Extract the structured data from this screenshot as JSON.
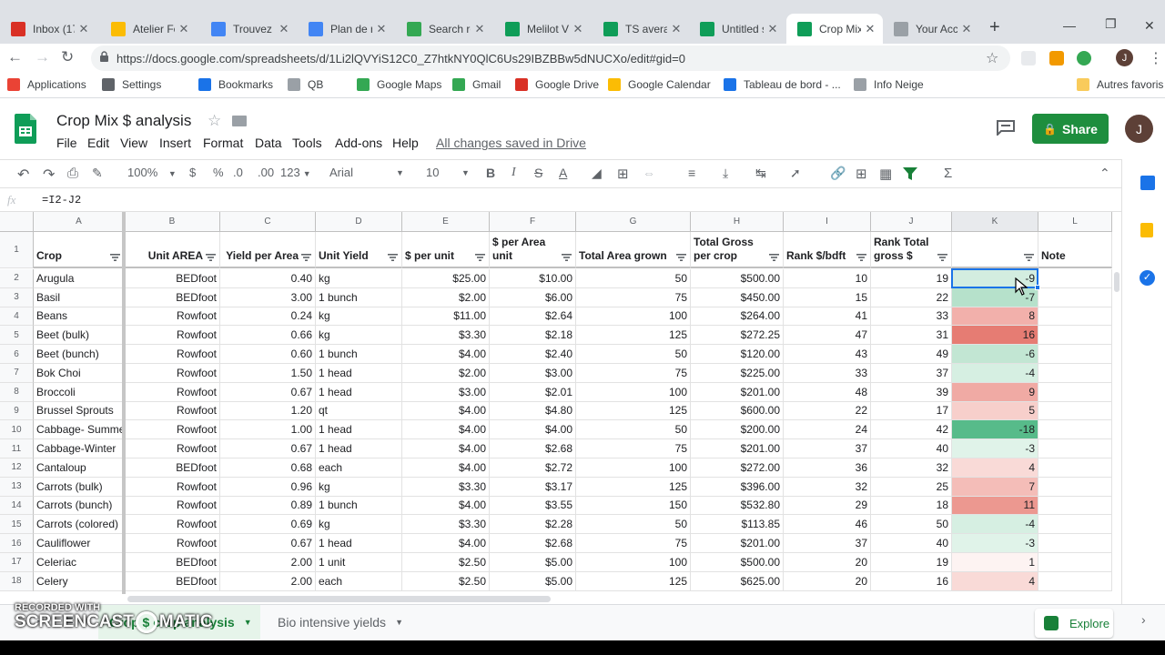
{
  "browser": {
    "tabs": [
      {
        "title": "Inbox (17",
        "color": "#d93025"
      },
      {
        "title": "Atelier Fe",
        "color": "#fbbc04"
      },
      {
        "title": "Trouvez l",
        "color": "#4285f4"
      },
      {
        "title": "Plan de r",
        "color": "#4285f4"
      },
      {
        "title": "Search re",
        "color": "#34a853"
      },
      {
        "title": "Melilot V",
        "color": "#0f9d58"
      },
      {
        "title": "TS averag",
        "color": "#0f9d58"
      },
      {
        "title": "Untitled s",
        "color": "#0f9d58"
      },
      {
        "title": "Crop Mix",
        "color": "#0f9d58"
      },
      {
        "title": "Your Acco",
        "color": "#9aa0a6"
      }
    ],
    "url": "https://docs.google.com/spreadsheets/d/1Li2lQVYiS12C0_Z7htkNY0QlC6Us29IBZBBw5dNUCXo/edit#gid=0",
    "bookmarks": [
      "Applications",
      "Settings",
      "Bookmarks",
      "QB",
      "Google Maps",
      "Gmail",
      "Google Drive",
      "Google Calendar",
      "Tableau de bord - ...",
      "Info Neige"
    ],
    "other_bookmarks": "Autres favoris"
  },
  "sheets": {
    "title": "Crop Mix $ analysis",
    "menu": [
      "File",
      "Edit",
      "View",
      "Insert",
      "Format",
      "Data",
      "Tools",
      "Add-ons",
      "Help"
    ],
    "saved_status": "All changes saved in Drive",
    "share_label": "Share",
    "avatar_letter": "J",
    "toolbar": {
      "zoom": "100%",
      "currency": "$",
      "percent": "%",
      "dec_less": ".0",
      "dec_more": ".00",
      "more_formats": "123",
      "font": "Arial",
      "size": "10"
    },
    "formula": "=I2-J2",
    "fx": "fx",
    "columns": [
      "A",
      "B",
      "C",
      "D",
      "E",
      "F",
      "G",
      "H",
      "I",
      "J",
      "K",
      "L"
    ],
    "headers": [
      "Crop",
      "Unit AREA",
      "Yield per Area",
      "Unit Yield",
      "$ per unit",
      "$ per Area unit",
      "Total Area grown",
      "Total Gross per crop",
      "Rank $/bdft",
      "Rank Total gross $",
      "",
      "Note"
    ],
    "rows": [
      {
        "n": "2",
        "a": "Arugula",
        "b": "BEDfoot",
        "c": "0.40",
        "d": "kg",
        "e": "$25.00",
        "f": "$10.00",
        "g": "50",
        "h": "$500.00",
        "i": "10",
        "j": "19",
        "k": "-9",
        "bg": "#d3ede0"
      },
      {
        "n": "3",
        "a": "Basil",
        "b": "BEDfoot",
        "c": "3.00",
        "d": "1 bunch",
        "e": "$2.00",
        "f": "$6.00",
        "g": "75",
        "h": "$450.00",
        "i": "15",
        "j": "22",
        "k": "-7",
        "bg": "#b6e1cb"
      },
      {
        "n": "4",
        "a": "Beans",
        "b": "Rowfoot",
        "c": "0.24",
        "d": "kg",
        "e": "$11.00",
        "f": "$2.64",
        "g": "100",
        "h": "$264.00",
        "i": "41",
        "j": "33",
        "k": "8",
        "bg": "#f2b0ab"
      },
      {
        "n": "5",
        "a": "Beet (bulk)",
        "b": "Rowfoot",
        "c": "0.66",
        "d": "kg",
        "e": "$3.30",
        "f": "$2.18",
        "g": "125",
        "h": "$272.25",
        "i": "47",
        "j": "31",
        "k": "16",
        "bg": "#e67c73"
      },
      {
        "n": "6",
        "a": "Beet (bunch)",
        "b": "Rowfoot",
        "c": "0.60",
        "d": "1 bunch",
        "e": "$4.00",
        "f": "$2.40",
        "g": "50",
        "h": "$120.00",
        "i": "43",
        "j": "49",
        "k": "-6",
        "bg": "#c2e6d3"
      },
      {
        "n": "7",
        "a": "Bok Choi",
        "b": "Rowfoot",
        "c": "1.50",
        "d": "1 head",
        "e": "$2.00",
        "f": "$3.00",
        "g": "75",
        "h": "$225.00",
        "i": "33",
        "j": "37",
        "k": "-4",
        "bg": "#d6efe2"
      },
      {
        "n": "8",
        "a": "Broccoli",
        "b": "Rowfoot",
        "c": "0.67",
        "d": "1 head",
        "e": "$3.00",
        "f": "$2.01",
        "g": "100",
        "h": "$201.00",
        "i": "48",
        "j": "39",
        "k": "9",
        "bg": "#f0aaa4"
      },
      {
        "n": "9",
        "a": "Brussel Sprouts",
        "b": "Rowfoot",
        "c": "1.20",
        "d": "qt",
        "e": "$4.00",
        "f": "$4.80",
        "g": "125",
        "h": "$600.00",
        "i": "22",
        "j": "17",
        "k": "5",
        "bg": "#f7cfcb"
      },
      {
        "n": "10",
        "a": "Cabbage- Summer",
        "b": "Rowfoot",
        "c": "1.00",
        "d": "1 head",
        "e": "$4.00",
        "f": "$4.00",
        "g": "50",
        "h": "$200.00",
        "i": "24",
        "j": "42",
        "k": "-18",
        "bg": "#57bb8a"
      },
      {
        "n": "11",
        "a": "Cabbage-Winter",
        "b": "Rowfoot",
        "c": "0.67",
        "d": "1 head",
        "e": "$4.00",
        "f": "$2.68",
        "g": "75",
        "h": "$201.00",
        "i": "37",
        "j": "40",
        "k": "-3",
        "bg": "#e0f3e9"
      },
      {
        "n": "12",
        "a": "Cantaloup",
        "b": "BEDfoot",
        "c": "0.68",
        "d": "each",
        "e": "$4.00",
        "f": "$2.72",
        "g": "100",
        "h": "$272.00",
        "i": "36",
        "j": "32",
        "k": "4",
        "bg": "#f9dad7"
      },
      {
        "n": "13",
        "a": "Carrots (bulk)",
        "b": "Rowfoot",
        "c": "0.96",
        "d": "kg",
        "e": "$3.30",
        "f": "$3.17",
        "g": "125",
        "h": "$396.00",
        "i": "32",
        "j": "25",
        "k": "7",
        "bg": "#f4bdb8"
      },
      {
        "n": "14",
        "a": "Carrots (bunch)",
        "b": "Rowfoot",
        "c": "0.89",
        "d": "1 bunch",
        "e": "$4.00",
        "f": "$3.55",
        "g": "150",
        "h": "$532.80",
        "i": "29",
        "j": "18",
        "k": "11",
        "bg": "#ec9890"
      },
      {
        "n": "15",
        "a": "Carrots (colored)",
        "b": "Rowfoot",
        "c": "0.69",
        "d": "kg",
        "e": "$3.30",
        "f": "$2.28",
        "g": "50",
        "h": "$113.85",
        "i": "46",
        "j": "50",
        "k": "-4",
        "bg": "#d6efe2"
      },
      {
        "n": "16",
        "a": "Cauliflower",
        "b": "Rowfoot",
        "c": "0.67",
        "d": "1 head",
        "e": "$4.00",
        "f": "$2.68",
        "g": "75",
        "h": "$201.00",
        "i": "37",
        "j": "40",
        "k": "-3",
        "bg": "#e0f3e9"
      },
      {
        "n": "17",
        "a": "Celeriac",
        "b": "BEDfoot",
        "c": "2.00",
        "d": "1 unit",
        "e": "$2.50",
        "f": "$5.00",
        "g": "100",
        "h": "$500.00",
        "i": "20",
        "j": "19",
        "k": "1",
        "bg": "#fdf3f2"
      },
      {
        "n": "18",
        "a": "Celery",
        "b": "BEDfoot",
        "c": "2.00",
        "d": "each",
        "e": "$2.50",
        "f": "$5.00",
        "g": "125",
        "h": "$625.00",
        "i": "20",
        "j": "16",
        "k": "4",
        "bg": "#f9dad7"
      }
    ],
    "sheet_tabs": [
      "Crop $ crop analysis",
      "Bio intensive yields"
    ],
    "explore_label": "Explore"
  },
  "watermark": {
    "line1": "RECORDED WITH",
    "line2": "SCREENCAST",
    "line3": "MATIC"
  }
}
